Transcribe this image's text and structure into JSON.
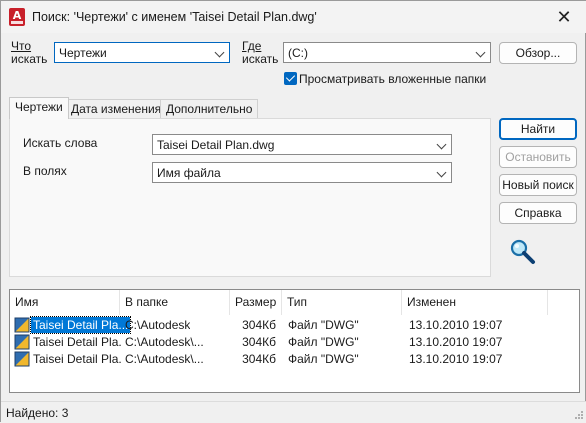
{
  "window": {
    "title": "Поиск: 'Чертежи' с именем 'Taisei Detail Plan.dwg'",
    "app_icon_letter": "A",
    "close_glyph": "✕"
  },
  "search": {
    "what_label_1": "Что",
    "what_label_2": "искать",
    "what_value": "Чертежи",
    "where_label_1": "Где",
    "where_label_2": "искать",
    "where_value": "(C:)",
    "browse_label": "Обзор...",
    "subfolders_label": "Просматривать вложенные папки",
    "subfolders_checked": true
  },
  "tabs": [
    {
      "label": "Чертежи",
      "active": true
    },
    {
      "label": "Дата изменения",
      "active": false
    },
    {
      "label": "Дополнительно",
      "active": false
    }
  ],
  "panel": {
    "words_label": "Искать слова",
    "words_value": "Taisei Detail Plan.dwg",
    "fields_label": "В полях",
    "fields_value": "Имя файла"
  },
  "actions": {
    "find": "Найти",
    "stop": "Остановить",
    "new_search": "Новый поиск",
    "help": "Справка"
  },
  "results": {
    "columns": [
      "Имя",
      "В папке",
      "Размер",
      "Тип",
      "Изменен"
    ],
    "rows": [
      {
        "name": "Taisei Detail Pla...",
        "folder": "C:\\Autodesk",
        "size": "304Кб",
        "type": "Файл \"DWG\"",
        "modified": "13.10.2010 19:07",
        "selected": true
      },
      {
        "name": "Taisei Detail Pla...",
        "folder": "C:\\Autodesk\\...",
        "size": "304Кб",
        "type": "Файл \"DWG\"",
        "modified": "13.10.2010 19:07",
        "selected": false
      },
      {
        "name": "Taisei Detail Pla...",
        "folder": "C:\\Autodesk\\...",
        "size": "304Кб",
        "type": "Файл \"DWG\"",
        "modified": "13.10.2010 19:07",
        "selected": false
      }
    ]
  },
  "status": {
    "found_text": "Найдено: 3"
  },
  "colors": {
    "accent": "#0067c0",
    "selection": "#0078d7",
    "app_red": "#c8202a"
  }
}
